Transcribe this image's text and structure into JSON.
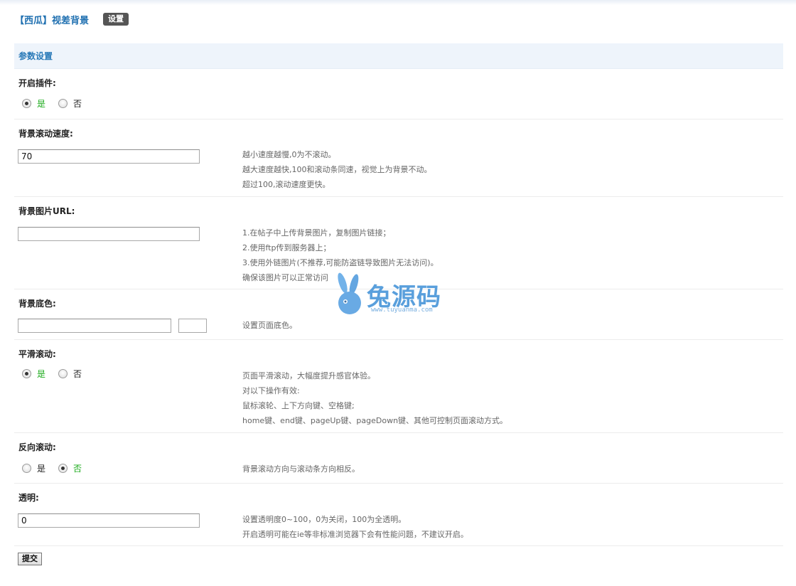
{
  "header": {
    "title": "【西瓜】视差背景",
    "settings_label": "设置"
  },
  "section": {
    "title": "参数设置"
  },
  "fields": {
    "enable": {
      "label": "开启插件:",
      "options": [
        "是",
        "否"
      ],
      "selected": "是"
    },
    "speed": {
      "label": "背景滚动速度:",
      "value": "70",
      "tips": [
        "越小速度越慢,0为不滚动。",
        "越大速度越快,100和滚动条同速，视觉上为背景不动。",
        "超过100,滚动速度更快。"
      ]
    },
    "image_url": {
      "label": "背景图片URL:",
      "value": "",
      "tips": [
        "1.在帖子中上传背景图片，复制图片链接；",
        "2.使用ftp传到服务器上；",
        "3.使用外链图片(不推荐,可能防盗链导致图片无法访问)。",
        "确保该图片可以正常访问"
      ]
    },
    "bg_color": {
      "label": "背景底色:",
      "value": "",
      "tips": [
        "设置页面底色。"
      ]
    },
    "smooth": {
      "label": "平滑滚动:",
      "options": [
        "是",
        "否"
      ],
      "selected": "是",
      "tips": [
        "页面平滑滚动，大幅度提升感官体验。",
        "对以下操作有效:",
        "鼠标滚轮、上下方向键、空格键;",
        "home键、end键、pageUp键、pageDown键、其他可控制页面滚动方式。"
      ]
    },
    "reverse": {
      "label": "反向滚动:",
      "options": [
        "是",
        "否"
      ],
      "selected": "否",
      "tips": [
        "背景滚动方向与滚动条方向相反。"
      ]
    },
    "opacity": {
      "label": "透明:",
      "value": "0",
      "tips": [
        "设置透明度0~100，0为关闭，100为全透明。",
        "开启透明可能在ie等非标准浏览器下会有性能问题，不建议开启。"
      ]
    }
  },
  "submit_label": "提交",
  "watermark": {
    "text": "兔源码",
    "url": "www.tuyuanma.com"
  }
}
